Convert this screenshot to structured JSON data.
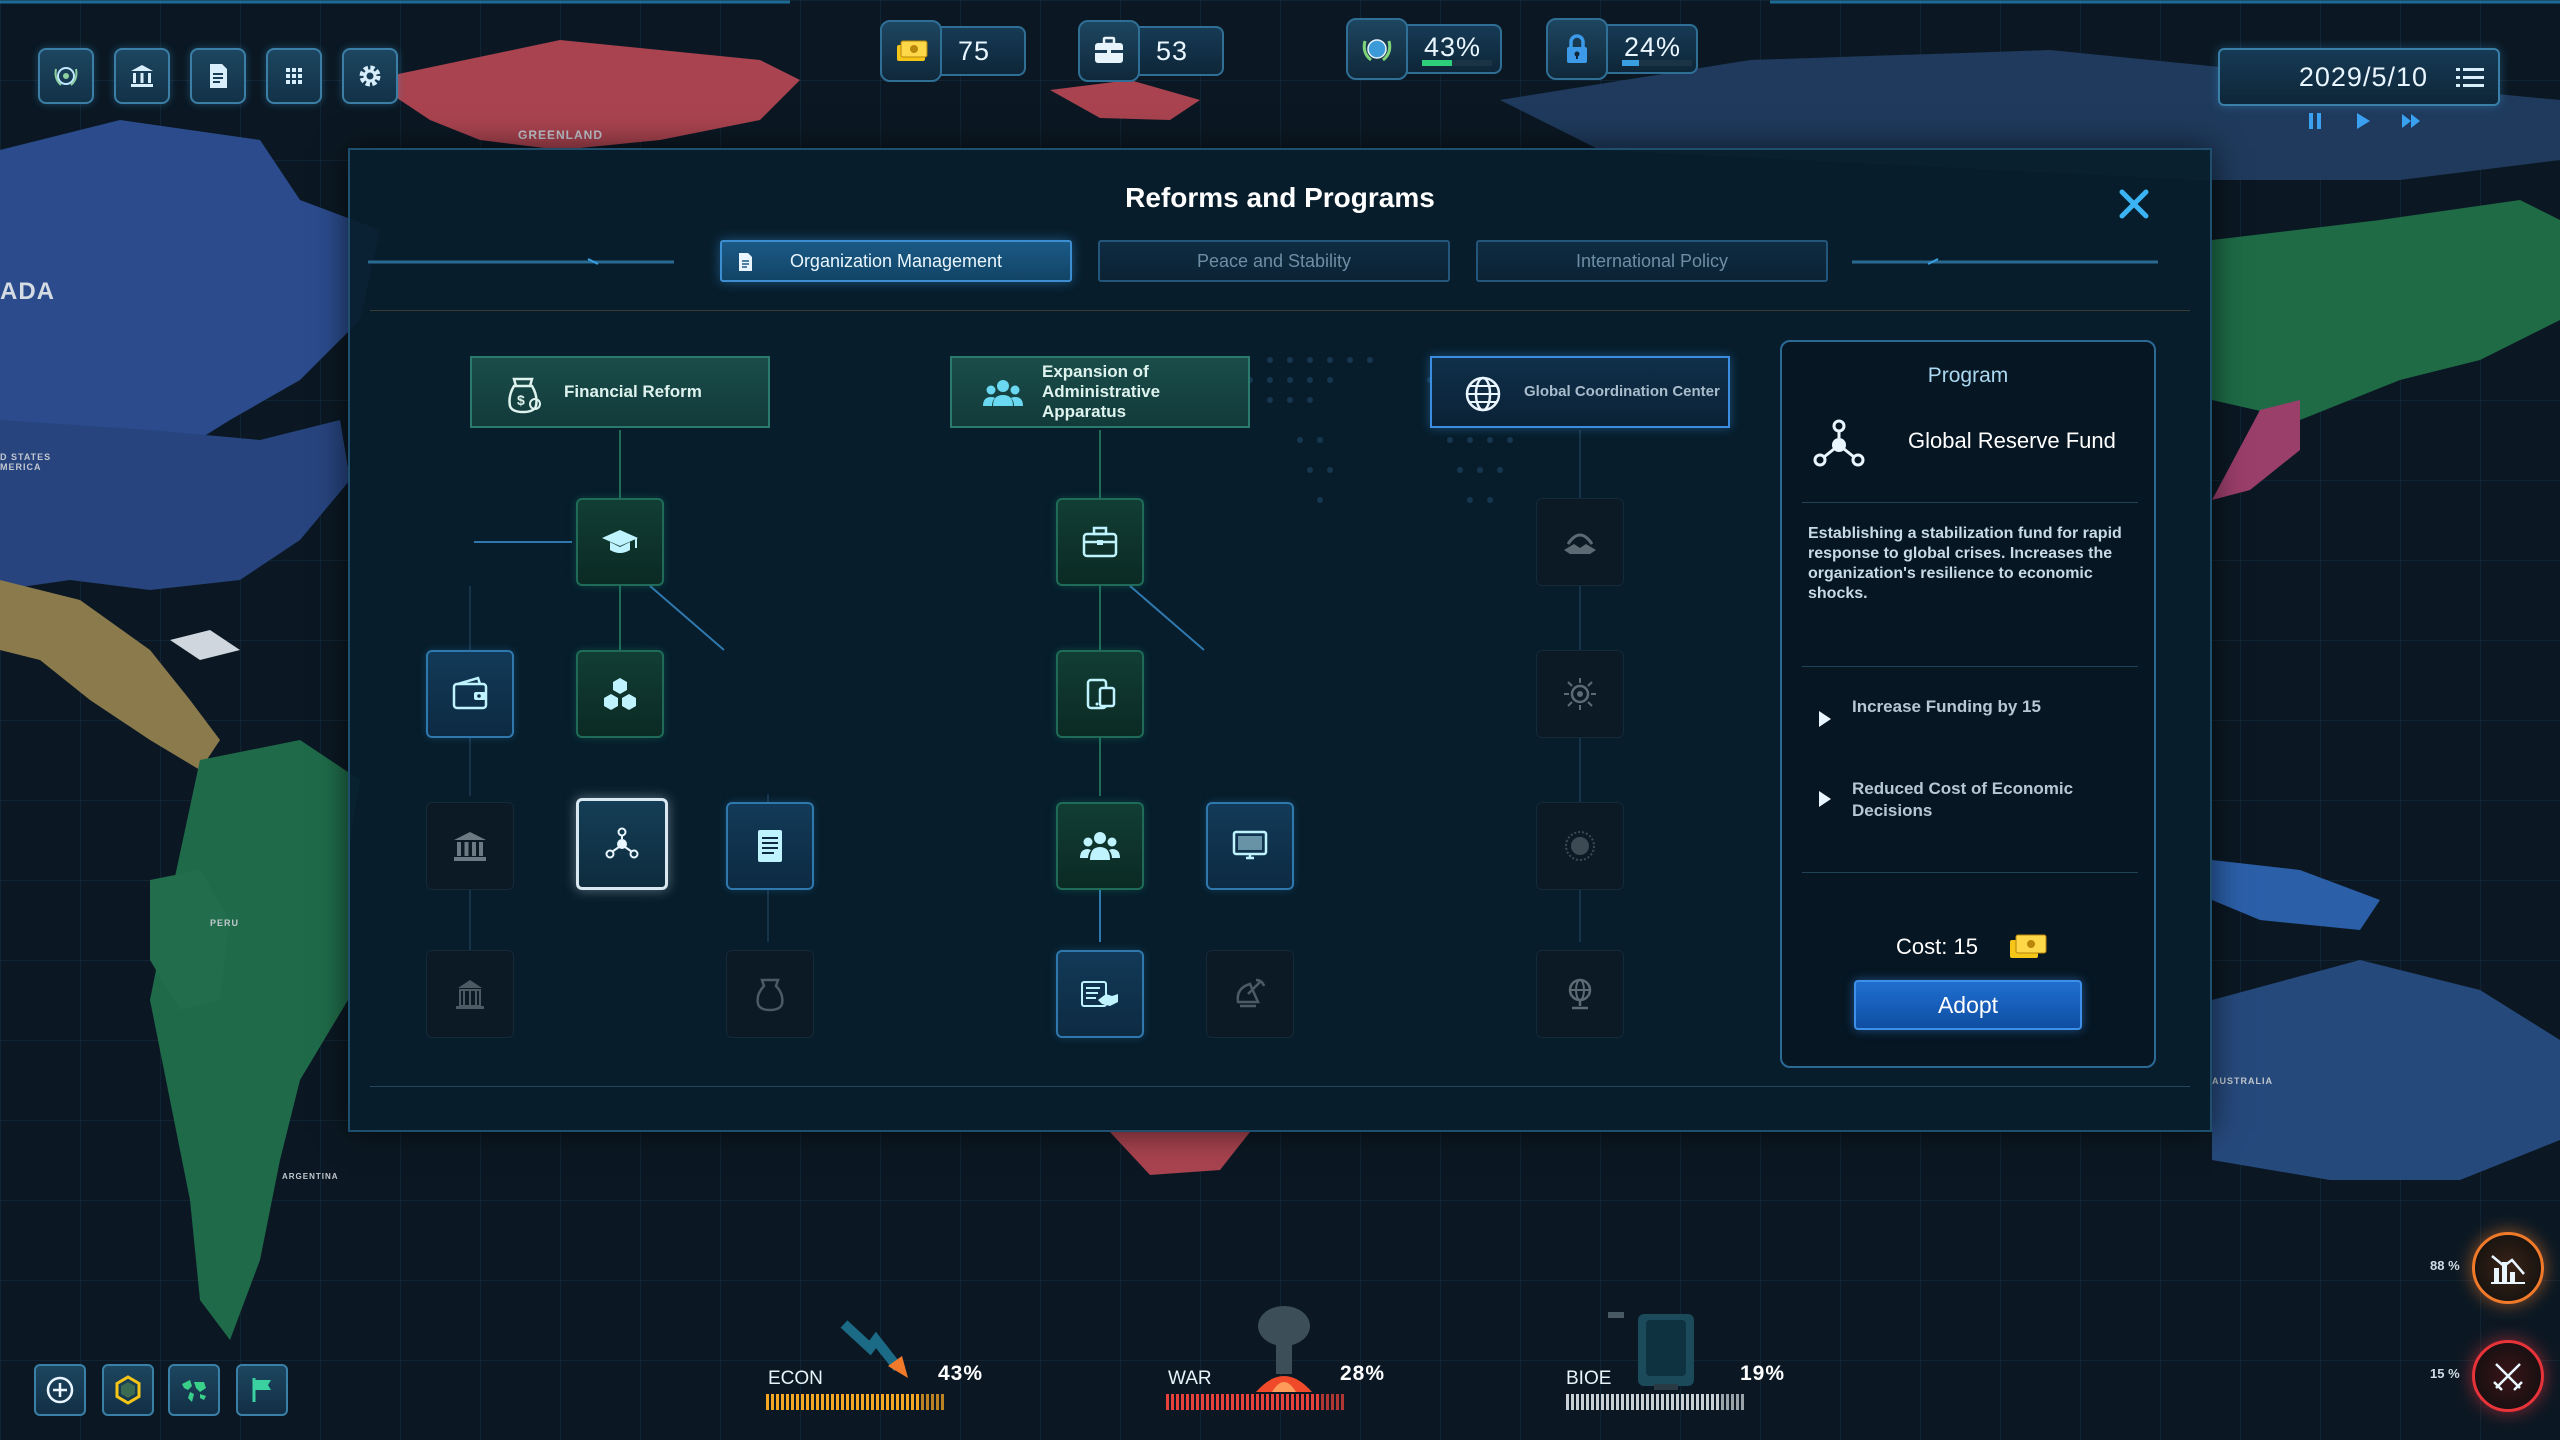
{
  "map": {
    "labels": [
      "GREENLAND",
      "ADA",
      "D STATES\nMERICA",
      "PERU",
      "ARGENTINA",
      "AUSTRALIA"
    ]
  },
  "top_bar": {
    "buttons": [
      "un-emblem-icon",
      "government-building-icon",
      "document-icon",
      "grid-menu-icon",
      "gear-icon"
    ],
    "resources": {
      "money": {
        "value": "75"
      },
      "supplies": {
        "value": "53"
      },
      "approval": {
        "value": "43%",
        "level": 0.43,
        "color": "#2ecf7a"
      },
      "security": {
        "value": "24%",
        "level": 0.24,
        "color": "#3a9fe0"
      }
    },
    "date": "2029/5/10"
  },
  "modal": {
    "title": "Reforms and Programs",
    "tabs": [
      {
        "label": "Organization Management",
        "active": true
      },
      {
        "label": "Peace and Stability",
        "active": false
      },
      {
        "label": "International Policy",
        "active": false
      }
    ],
    "branches": [
      {
        "label": "Financial Reform",
        "icon": "money-bag-icon",
        "state": "active"
      },
      {
        "label": "Expansion of Administrative Apparatus",
        "icon": "people-group-icon",
        "state": "active"
      },
      {
        "label": "Global Coordination Center",
        "icon": "globe-icon",
        "state": "selected"
      }
    ],
    "nodes": [
      {
        "name": "education-cap-icon",
        "state": "green"
      },
      {
        "name": "wallet-icon",
        "state": "blue"
      },
      {
        "name": "cubes-icon",
        "state": "green"
      },
      {
        "name": "bank-icon",
        "state": "dark"
      },
      {
        "name": "network-hub-icon",
        "state": "selected"
      },
      {
        "name": "report-document-icon",
        "state": "blue"
      },
      {
        "name": "institution-icon",
        "state": "dark"
      },
      {
        "name": "money-sack-icon",
        "state": "dark"
      },
      {
        "name": "briefcase-icon",
        "state": "green"
      },
      {
        "name": "mobile-device-icon",
        "state": "green"
      },
      {
        "name": "team-icon",
        "state": "green"
      },
      {
        "name": "computer-monitor-icon",
        "state": "blue"
      },
      {
        "name": "handshake-icon",
        "state": "blue"
      },
      {
        "name": "satellite-dish-icon",
        "state": "dark"
      },
      {
        "name": "world-hands-icon",
        "state": "dark"
      },
      {
        "name": "radar-icon",
        "state": "dark"
      },
      {
        "name": "circle-target-icon",
        "state": "dark"
      },
      {
        "name": "globe-stand-icon",
        "state": "dark"
      }
    ],
    "program_panel": {
      "header": "Program",
      "name": "Global Reserve Fund",
      "description": "Establishing a stabilization fund for rapid response to global crises. Increases the organization's resilience to economic shocks.",
      "effects": [
        "Increase Funding by 15",
        "Reduced Cost of Economic Decisions"
      ],
      "cost_label": "Cost: 15",
      "adopt_label": "Adopt"
    }
  },
  "bottom_bar": {
    "buttons": [
      "plus-circle-icon",
      "hexagon-icon",
      "world-map-icon",
      "flag-icon"
    ],
    "gauges": [
      {
        "name": "ECON",
        "value": "43%",
        "level": 0.43,
        "color": "#f5a623"
      },
      {
        "name": "WAR",
        "value": "28%",
        "level": 0.28,
        "color": "#e8403a"
      },
      {
        "name": "BIOE",
        "value": "19%",
        "level": 0.19,
        "color": "#c8d0d6"
      }
    ],
    "side_alerts": [
      {
        "value": "88 %",
        "color": "#f07a2a"
      },
      {
        "value": "15 %",
        "color": "#e8333a"
      }
    ]
  }
}
